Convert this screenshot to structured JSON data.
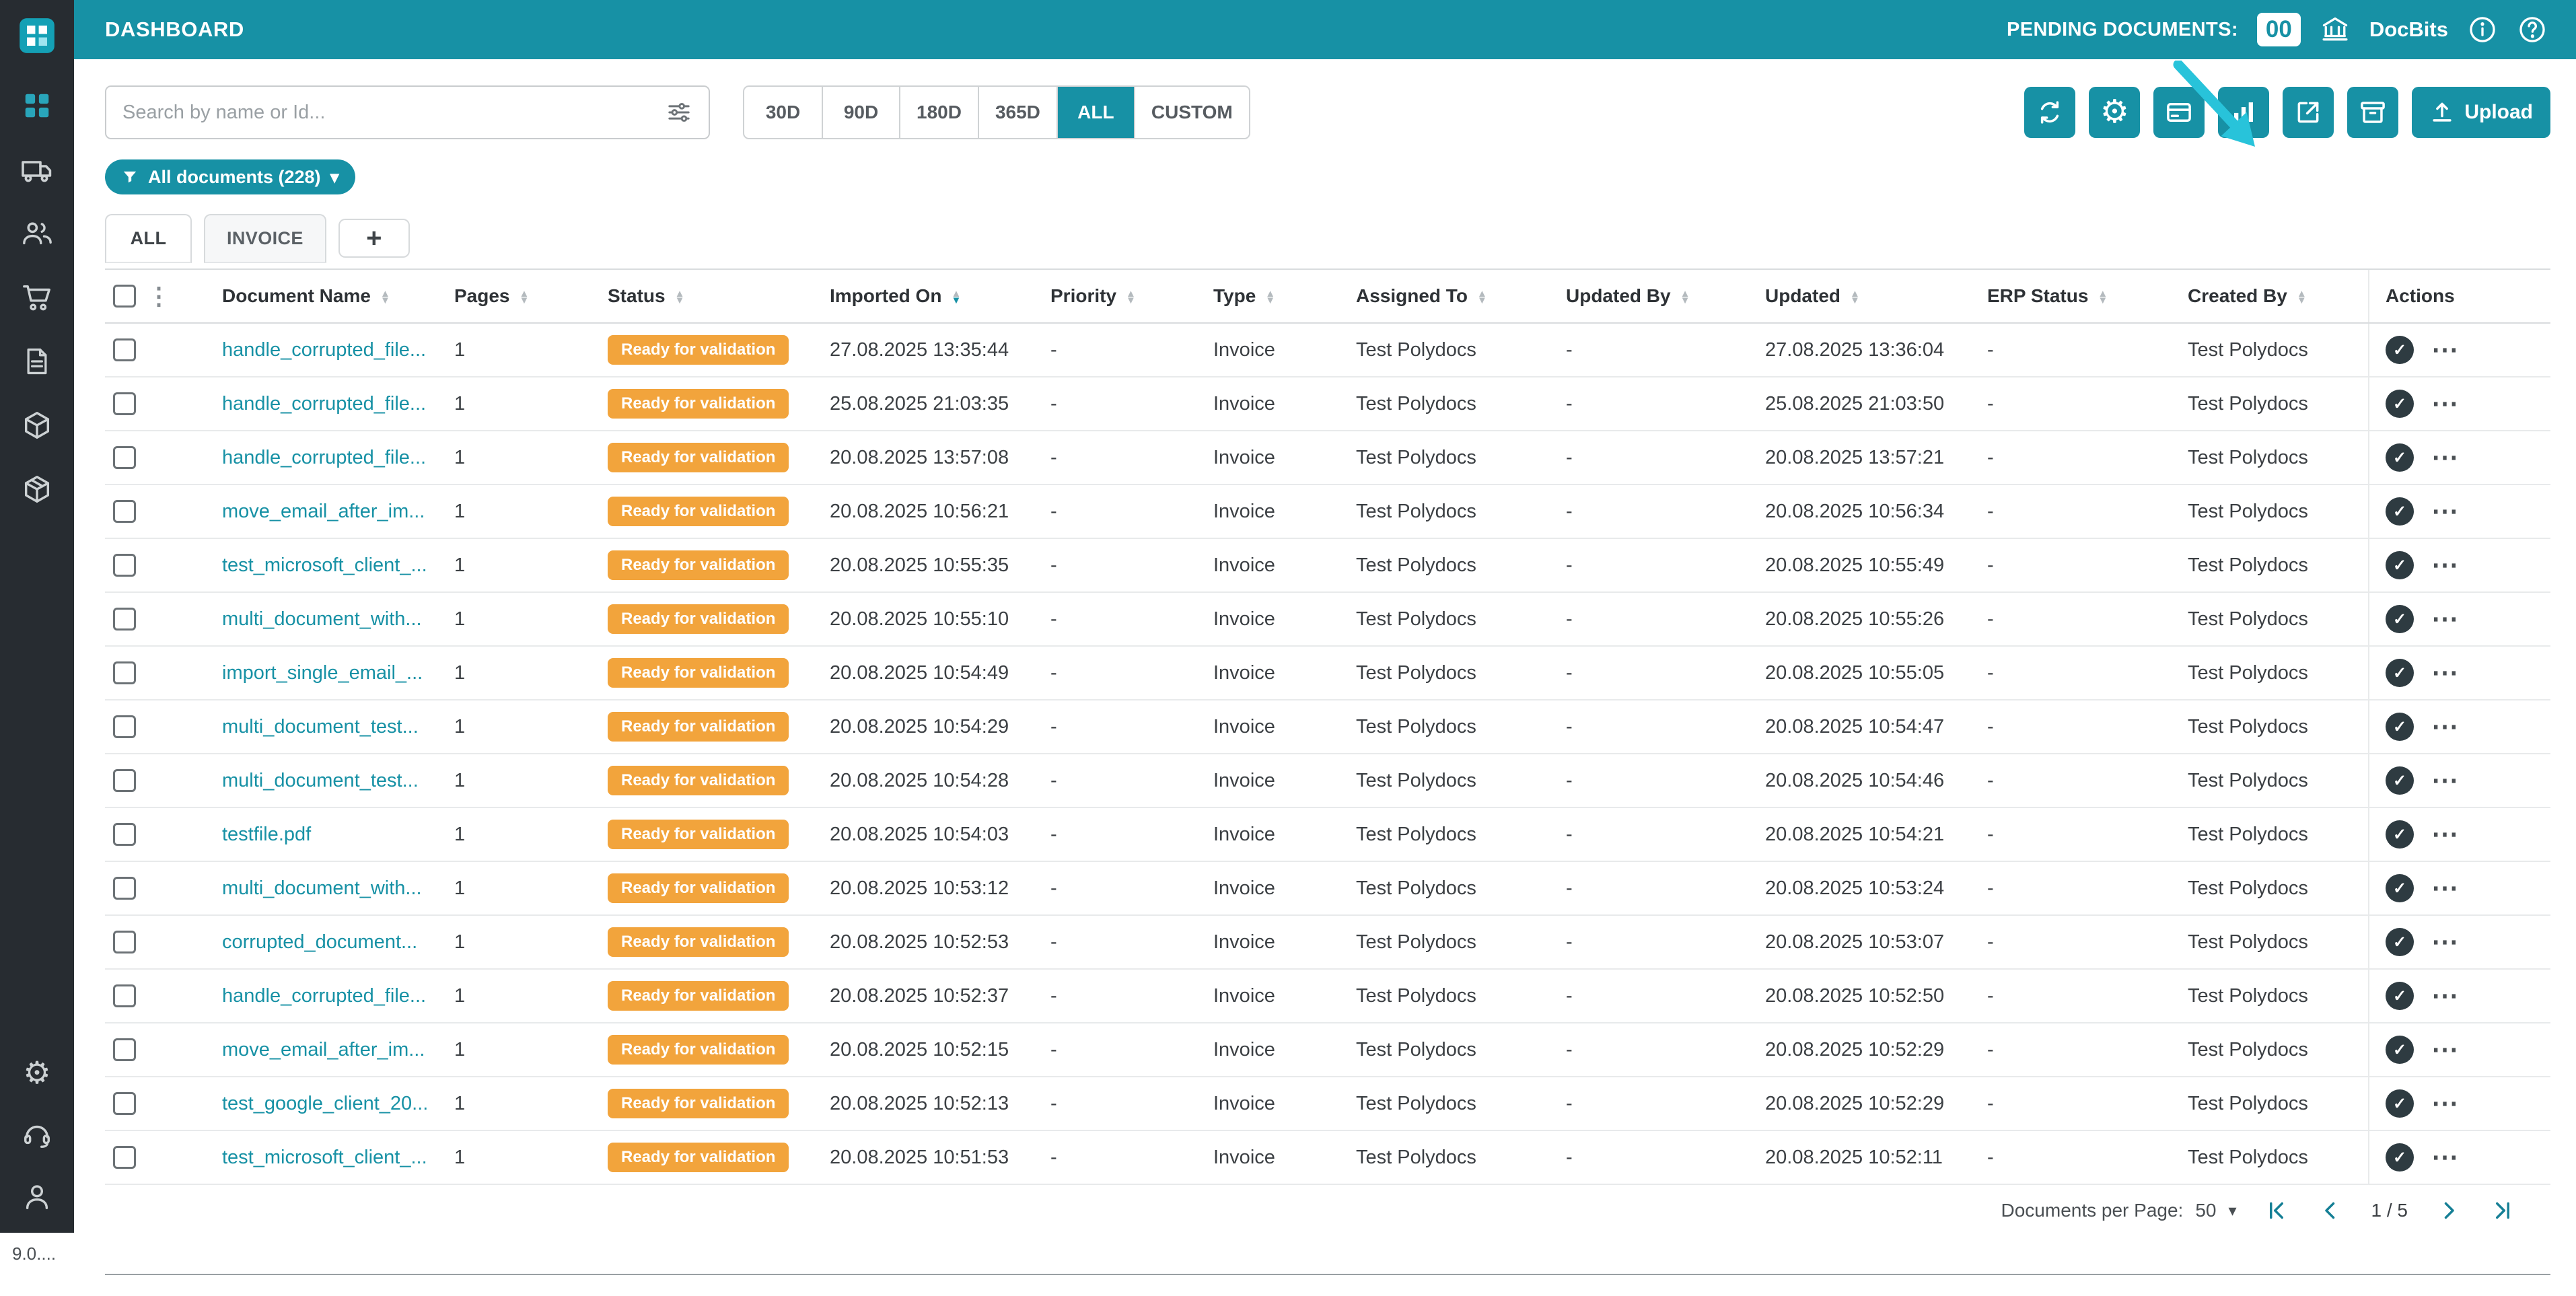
{
  "topbar": {
    "title": "DASHBOARD",
    "pending_label": "PENDING DOCUMENTS:",
    "pending_count": "00",
    "brand": "DocBits"
  },
  "sidebar": {
    "version": "9.0...."
  },
  "filters": {
    "search_placeholder": "Search by name or Id...",
    "ranges": [
      "30D",
      "90D",
      "180D",
      "365D",
      "ALL",
      "CUSTOM"
    ],
    "active_range": "ALL",
    "documents_chip": "All documents (228)"
  },
  "toolbar": {
    "upload_label": "Upload"
  },
  "tabs": [
    {
      "label": "ALL",
      "active": true
    },
    {
      "label": "INVOICE",
      "active": false
    }
  ],
  "table": {
    "columns": [
      "Document Name",
      "Pages",
      "Status",
      "Imported On",
      "Priority",
      "Type",
      "Assigned To",
      "Updated By",
      "Updated",
      "ERP Status",
      "Created By",
      "Actions"
    ],
    "sorted_column": "Imported On",
    "rows": [
      {
        "name": "handle_corrupted_file...",
        "pages": "1",
        "status": "Ready for validation",
        "imported": "27.08.2025 13:35:44",
        "priority": "-",
        "type": "Invoice",
        "assigned": "Test Polydocs",
        "updated_by": "-",
        "updated": "27.08.2025 13:36:04",
        "erp": "-",
        "created_by": "Test Polydocs"
      },
      {
        "name": "handle_corrupted_file...",
        "pages": "1",
        "status": "Ready for validation",
        "imported": "25.08.2025 21:03:35",
        "priority": "-",
        "type": "Invoice",
        "assigned": "Test Polydocs",
        "updated_by": "-",
        "updated": "25.08.2025 21:03:50",
        "erp": "-",
        "created_by": "Test Polydocs"
      },
      {
        "name": "handle_corrupted_file...",
        "pages": "1",
        "status": "Ready for validation",
        "imported": "20.08.2025 13:57:08",
        "priority": "-",
        "type": "Invoice",
        "assigned": "Test Polydocs",
        "updated_by": "-",
        "updated": "20.08.2025 13:57:21",
        "erp": "-",
        "created_by": "Test Polydocs"
      },
      {
        "name": "move_email_after_im...",
        "pages": "1",
        "status": "Ready for validation",
        "imported": "20.08.2025 10:56:21",
        "priority": "-",
        "type": "Invoice",
        "assigned": "Test Polydocs",
        "updated_by": "-",
        "updated": "20.08.2025 10:56:34",
        "erp": "-",
        "created_by": "Test Polydocs"
      },
      {
        "name": "test_microsoft_client_...",
        "pages": "1",
        "status": "Ready for validation",
        "imported": "20.08.2025 10:55:35",
        "priority": "-",
        "type": "Invoice",
        "assigned": "Test Polydocs",
        "updated_by": "-",
        "updated": "20.08.2025 10:55:49",
        "erp": "-",
        "created_by": "Test Polydocs"
      },
      {
        "name": "multi_document_with...",
        "pages": "1",
        "status": "Ready for validation",
        "imported": "20.08.2025 10:55:10",
        "priority": "-",
        "type": "Invoice",
        "assigned": "Test Polydocs",
        "updated_by": "-",
        "updated": "20.08.2025 10:55:26",
        "erp": "-",
        "created_by": "Test Polydocs"
      },
      {
        "name": "import_single_email_...",
        "pages": "1",
        "status": "Ready for validation",
        "imported": "20.08.2025 10:54:49",
        "priority": "-",
        "type": "Invoice",
        "assigned": "Test Polydocs",
        "updated_by": "-",
        "updated": "20.08.2025 10:55:05",
        "erp": "-",
        "created_by": "Test Polydocs"
      },
      {
        "name": "multi_document_test...",
        "pages": "1",
        "status": "Ready for validation",
        "imported": "20.08.2025 10:54:29",
        "priority": "-",
        "type": "Invoice",
        "assigned": "Test Polydocs",
        "updated_by": "-",
        "updated": "20.08.2025 10:54:47",
        "erp": "-",
        "created_by": "Test Polydocs"
      },
      {
        "name": "multi_document_test...",
        "pages": "1",
        "status": "Ready for validation",
        "imported": "20.08.2025 10:54:28",
        "priority": "-",
        "type": "Invoice",
        "assigned": "Test Polydocs",
        "updated_by": "-",
        "updated": "20.08.2025 10:54:46",
        "erp": "-",
        "created_by": "Test Polydocs"
      },
      {
        "name": "testfile.pdf",
        "pages": "1",
        "status": "Ready for validation",
        "imported": "20.08.2025 10:54:03",
        "priority": "-",
        "type": "Invoice",
        "assigned": "Test Polydocs",
        "updated_by": "-",
        "updated": "20.08.2025 10:54:21",
        "erp": "-",
        "created_by": "Test Polydocs"
      },
      {
        "name": "multi_document_with...",
        "pages": "1",
        "status": "Ready for validation",
        "imported": "20.08.2025 10:53:12",
        "priority": "-",
        "type": "Invoice",
        "assigned": "Test Polydocs",
        "updated_by": "-",
        "updated": "20.08.2025 10:53:24",
        "erp": "-",
        "created_by": "Test Polydocs"
      },
      {
        "name": "corrupted_document...",
        "pages": "1",
        "status": "Ready for validation",
        "imported": "20.08.2025 10:52:53",
        "priority": "-",
        "type": "Invoice",
        "assigned": "Test Polydocs",
        "updated_by": "-",
        "updated": "20.08.2025 10:53:07",
        "erp": "-",
        "created_by": "Test Polydocs"
      },
      {
        "name": "handle_corrupted_file...",
        "pages": "1",
        "status": "Ready for validation",
        "imported": "20.08.2025 10:52:37",
        "priority": "-",
        "type": "Invoice",
        "assigned": "Test Polydocs",
        "updated_by": "-",
        "updated": "20.08.2025 10:52:50",
        "erp": "-",
        "created_by": "Test Polydocs"
      },
      {
        "name": "move_email_after_im...",
        "pages": "1",
        "status": "Ready for validation",
        "imported": "20.08.2025 10:52:15",
        "priority": "-",
        "type": "Invoice",
        "assigned": "Test Polydocs",
        "updated_by": "-",
        "updated": "20.08.2025 10:52:29",
        "erp": "-",
        "created_by": "Test Polydocs"
      },
      {
        "name": "test_google_client_20...",
        "pages": "1",
        "status": "Ready for validation",
        "imported": "20.08.2025 10:52:13",
        "priority": "-",
        "type": "Invoice",
        "assigned": "Test Polydocs",
        "updated_by": "-",
        "updated": "20.08.2025 10:52:29",
        "erp": "-",
        "created_by": "Test Polydocs"
      },
      {
        "name": "test_microsoft_client_...",
        "pages": "1",
        "status": "Ready for validation",
        "imported": "20.08.2025 10:51:53",
        "priority": "-",
        "type": "Invoice",
        "assigned": "Test Polydocs",
        "updated_by": "-",
        "updated": "20.08.2025 10:52:11",
        "erp": "-",
        "created_by": "Test Polydocs"
      }
    ]
  },
  "pagination": {
    "per_page_label": "Documents per Page:",
    "per_page": "50",
    "page_indicator": "1 / 5"
  },
  "icons": {
    "sort_asc": "▲",
    "sort_desc": "▼",
    "kebab": "⋮",
    "ellipsis": "⋯",
    "check": "✓",
    "chevron_down": "▾",
    "caret_down": "▾",
    "plus": "+",
    "gear": "⚙"
  },
  "colors": {
    "accent": "#1791a5",
    "status_badge": "#f2a43c",
    "sidebar": "#272c31",
    "cursor_arrow": "#28c3da"
  }
}
